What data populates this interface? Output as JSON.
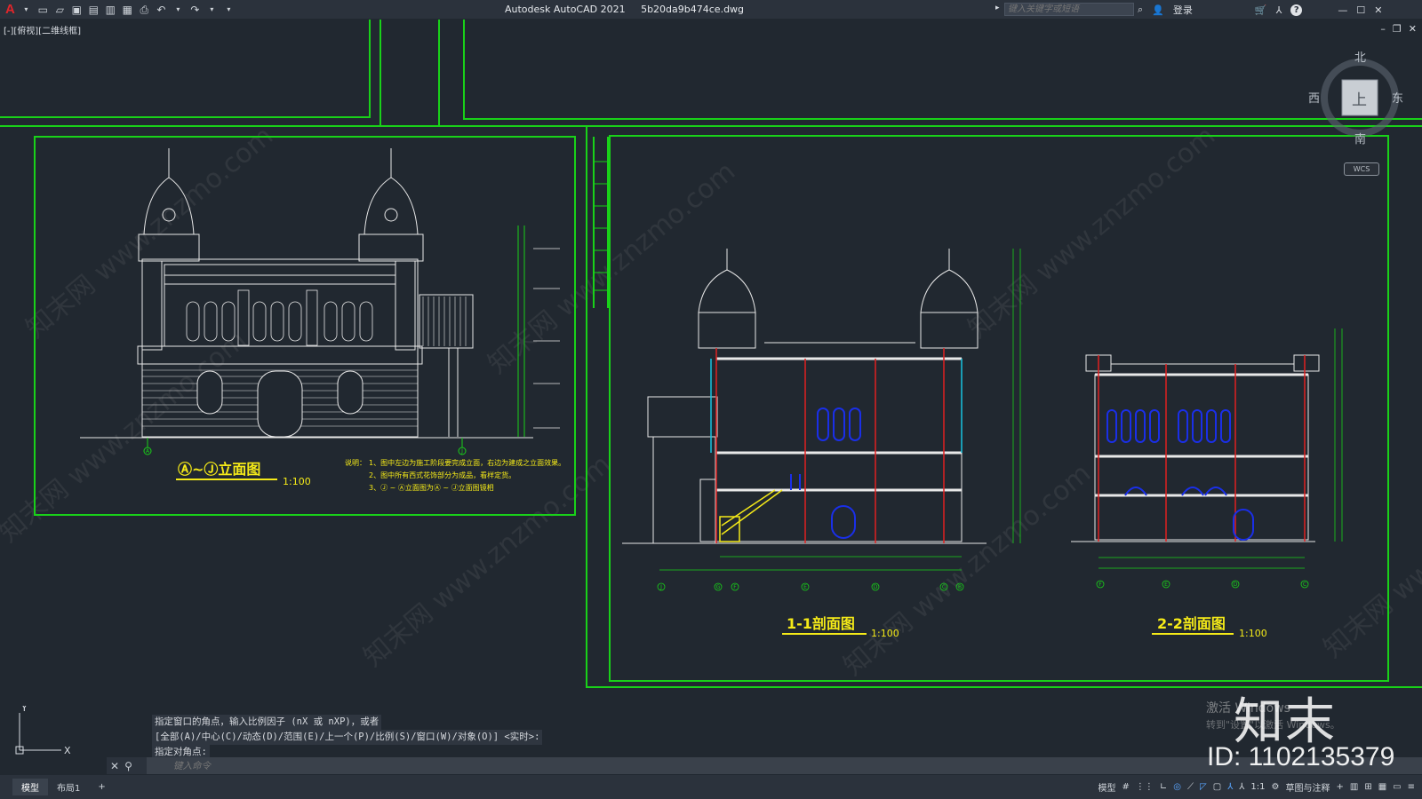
{
  "titlebar": {
    "app_title": "Autodesk AutoCAD 2021",
    "file_name": "5b20da9b474ce.dwg",
    "search_placeholder": "键入关键字或短语",
    "login_label": "登录",
    "help_icon": "question-icon"
  },
  "viewport": {
    "label": "[-][俯视][二维线框]"
  },
  "viewcube": {
    "north": "北",
    "south": "南",
    "east": "东",
    "west": "西",
    "face": "上",
    "wcs": "WCS"
  },
  "drawing": {
    "elevation_title": "Ⓐ~Ⓙ立面图",
    "elevation_scale": "1:100",
    "notes_label": "说明：",
    "notes": [
      "1、图中左边为施工阶段要完成立面，右边为建成之立面效果。",
      "2、图中所有西式花饰部分为成品，看样定货。",
      "3、Ⓙ ~ Ⓐ立面图为Ⓐ ~ Ⓙ立面图镜相"
    ],
    "section1_title": "1-1剖面图",
    "section1_scale": "1:100",
    "section2_title": "2-2剖面图",
    "section2_scale": "1:100",
    "elevation_axis_labels": [
      "A",
      "J"
    ],
    "section1_axis_labels": [
      "J",
      "G",
      "F",
      "E",
      "D",
      "C",
      "B"
    ],
    "section2_axis_labels": [
      "F",
      "E",
      "D",
      "C"
    ]
  },
  "command": {
    "history": [
      "指定窗口的角点，输入比例因子 (nX 或 nXP)，或者",
      "[全部(A)/中心(C)/动态(D)/范围(E)/上一个(P)/比例(S)/窗口(W)/对象(O)] <实时>:",
      "指定对角点:"
    ],
    "input_placeholder": "键入命令"
  },
  "statusbar": {
    "tabs": [
      "模型",
      "布局1"
    ],
    "add_tab": "+",
    "model_label": "模型",
    "scale": "1:1",
    "workspace": "草图与注释"
  },
  "overlay": {
    "activate_line1": "激活 Windows",
    "activate_line2": "转到\"设置\"以激活 Windows。",
    "brand": "知末",
    "id_text": "ID: 1102135379",
    "diag_watermark": "知末网 www.znzmo.com"
  },
  "colors": {
    "background": "#212830",
    "frame_green": "#19d119",
    "line_white": "#e8e8e8",
    "title_yellow": "#f5ea18",
    "blue": "#1a2fe8",
    "red": "#e02020",
    "cyan": "#19c3e0",
    "accent_red": "#e0262b"
  }
}
